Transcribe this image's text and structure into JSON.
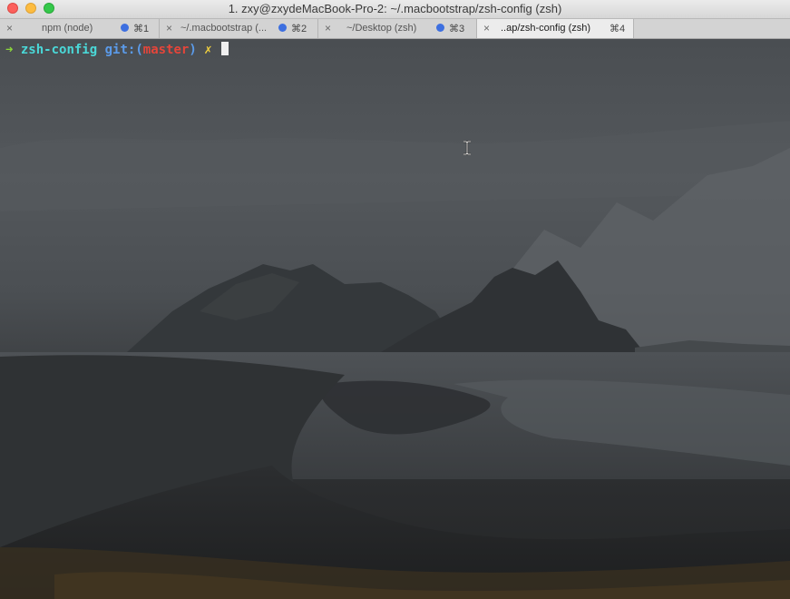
{
  "window": {
    "title": "1. zxy@zxydeMacBook-Pro-2: ~/.macbootstrap/zsh-config (zsh)"
  },
  "tabs": [
    {
      "label": "npm (node)",
      "shortcut": "⌘1",
      "active": false
    },
    {
      "label": "~/.macbootstrap (...",
      "shortcut": "⌘2",
      "active": false
    },
    {
      "label": "~/Desktop (zsh)",
      "shortcut": "⌘3",
      "active": false
    },
    {
      "label": "..ap/zsh-config (zsh)",
      "shortcut": "⌘4",
      "active": true
    }
  ],
  "terminal": {
    "prompt_arrow": "➜",
    "directory": "zsh-config",
    "git_prefix": "git:(",
    "branch": "master",
    "git_suffix": ")",
    "dirty_mark": "✗"
  },
  "colors": {
    "arrow": "#8bd83a",
    "directory": "#4ad8d8",
    "git": "#5b9bea",
    "branch": "#e5453a",
    "dirty": "#f2d13e",
    "tab_indicator": "#3d6fe0"
  },
  "icons": {
    "close": "×",
    "tab_close": "×",
    "text_cursor": "i-beam"
  }
}
